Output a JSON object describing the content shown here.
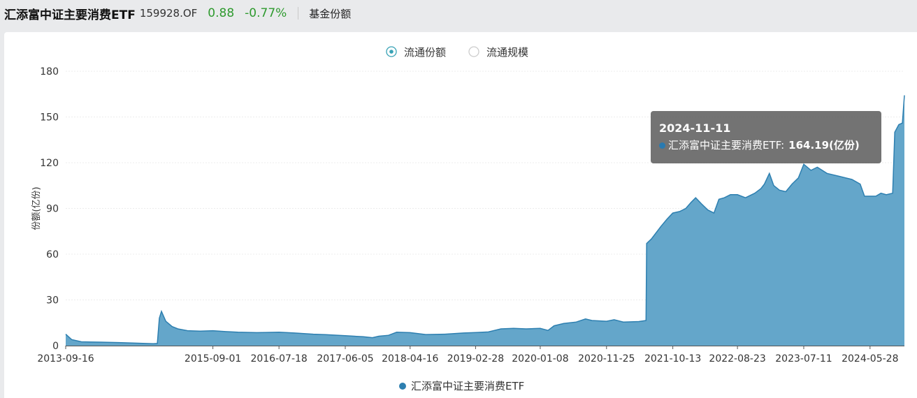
{
  "header": {
    "fund_name": "汇添富中证主要消费ETF",
    "fund_code": "159928.OF",
    "price": "0.88",
    "change": "-0.77%",
    "tab_label": "基金份额"
  },
  "toggles": [
    {
      "label": "流通份额",
      "selected": true
    },
    {
      "label": "流通规模",
      "selected": false
    }
  ],
  "tooltip": {
    "date": "2024-11-11",
    "series_label": "汇添富中证主要消费ETF:",
    "value_text": "164.19(亿份)"
  },
  "colors": {
    "fill": "#64a6ca",
    "line": "#2d7fb0",
    "up_down_green": "#2e9a2e"
  },
  "chart_data": {
    "type": "area",
    "ylabel": "份额(亿份)",
    "ylim": [
      0,
      180
    ],
    "yticks": [
      0,
      30,
      60,
      90,
      120,
      150,
      180
    ],
    "xticks": [
      "2013-09-16",
      "2015-09-01",
      "2016-07-18",
      "2017-06-05",
      "2018-04-16",
      "2019-02-28",
      "2020-01-08",
      "2020-11-25",
      "2021-10-13",
      "2022-08-23",
      "2023-07-11",
      "2024-05-28"
    ],
    "x_end": "2024-11-11",
    "legend": [
      "汇添富中证主要消费ETF"
    ],
    "series": [
      {
        "name": "汇添富中证主要消费ETF",
        "points": [
          [
            "2013-09-16",
            7.5
          ],
          [
            "2013-10-15",
            4.0
          ],
          [
            "2013-12-01",
            2.5
          ],
          [
            "2014-03-01",
            2.3
          ],
          [
            "2014-06-01",
            2.0
          ],
          [
            "2014-09-01",
            1.6
          ],
          [
            "2014-11-15",
            1.3
          ],
          [
            "2014-12-05",
            1.4
          ],
          [
            "2014-12-15",
            18.0
          ],
          [
            "2014-12-25",
            22.5
          ],
          [
            "2015-01-15",
            16.0
          ],
          [
            "2015-02-15",
            12.5
          ],
          [
            "2015-03-15",
            11.0
          ],
          [
            "2015-05-01",
            9.8
          ],
          [
            "2015-07-01",
            9.5
          ],
          [
            "2015-09-01",
            9.8
          ],
          [
            "2015-11-01",
            9.2
          ],
          [
            "2016-01-01",
            8.8
          ],
          [
            "2016-04-01",
            8.5
          ],
          [
            "2016-07-18",
            8.8
          ],
          [
            "2016-10-01",
            8.3
          ],
          [
            "2017-01-01",
            7.5
          ],
          [
            "2017-03-01",
            7.2
          ],
          [
            "2017-06-05",
            6.5
          ],
          [
            "2017-09-01",
            5.8
          ],
          [
            "2017-10-15",
            5.2
          ],
          [
            "2017-11-15",
            6.2
          ],
          [
            "2018-01-01",
            6.8
          ],
          [
            "2018-02-10",
            8.8
          ],
          [
            "2018-04-16",
            8.5
          ],
          [
            "2018-07-01",
            7.3
          ],
          [
            "2018-10-01",
            7.5
          ],
          [
            "2019-01-01",
            8.3
          ],
          [
            "2019-02-28",
            8.6
          ],
          [
            "2019-05-01",
            9.0
          ],
          [
            "2019-07-01",
            11.0
          ],
          [
            "2019-09-01",
            11.3
          ],
          [
            "2019-11-01",
            11.0
          ],
          [
            "2020-01-08",
            11.3
          ],
          [
            "2020-02-15",
            10.0
          ],
          [
            "2020-03-15",
            13.0
          ],
          [
            "2020-05-01",
            14.5
          ],
          [
            "2020-07-01",
            15.5
          ],
          [
            "2020-08-15",
            17.5
          ],
          [
            "2020-09-15",
            16.5
          ],
          [
            "2020-11-25",
            16.0
          ],
          [
            "2021-01-01",
            17.0
          ],
          [
            "2021-02-15",
            15.5
          ],
          [
            "2021-05-01",
            15.8
          ],
          [
            "2021-06-05",
            16.5
          ],
          [
            "2021-06-08",
            67.0
          ],
          [
            "2021-07-01",
            70.0
          ],
          [
            "2021-08-15",
            78.0
          ],
          [
            "2021-09-15",
            83.0
          ],
          [
            "2021-10-13",
            87.0
          ],
          [
            "2021-11-15",
            88.0
          ],
          [
            "2021-12-15",
            90.0
          ],
          [
            "2022-01-10",
            94.0
          ],
          [
            "2022-02-01",
            97.0
          ],
          [
            "2022-03-01",
            93.0
          ],
          [
            "2022-04-01",
            89.0
          ],
          [
            "2022-05-01",
            87.0
          ],
          [
            "2022-05-25",
            96.0
          ],
          [
            "2022-06-20",
            97.0
          ],
          [
            "2022-07-20",
            99.0
          ],
          [
            "2022-08-23",
            99.0
          ],
          [
            "2022-10-01",
            97.0
          ],
          [
            "2022-11-15",
            100.0
          ],
          [
            "2022-12-15",
            103.0
          ],
          [
            "2023-01-01",
            106.0
          ],
          [
            "2023-01-25",
            113.0
          ],
          [
            "2023-02-15",
            105.0
          ],
          [
            "2023-03-15",
            102.0
          ],
          [
            "2023-04-15",
            101.0
          ],
          [
            "2023-05-15",
            106.0
          ],
          [
            "2023-06-15",
            110.0
          ],
          [
            "2023-07-11",
            119.0
          ],
          [
            "2023-08-15",
            115.0
          ],
          [
            "2023-09-15",
            117.0
          ],
          [
            "2023-11-01",
            113.0
          ],
          [
            "2024-01-01",
            111.0
          ],
          [
            "2024-03-01",
            109.0
          ],
          [
            "2024-04-10",
            106.0
          ],
          [
            "2024-05-01",
            98.0
          ],
          [
            "2024-05-28",
            98.0
          ],
          [
            "2024-06-25",
            98.0
          ],
          [
            "2024-07-20",
            100.0
          ],
          [
            "2024-08-15",
            99.0
          ],
          [
            "2024-09-15",
            100.0
          ],
          [
            "2024-09-25",
            140.0
          ],
          [
            "2024-10-15",
            145.0
          ],
          [
            "2024-11-01",
            146.0
          ],
          [
            "2024-11-11",
            164.19
          ]
        ]
      }
    ]
  }
}
